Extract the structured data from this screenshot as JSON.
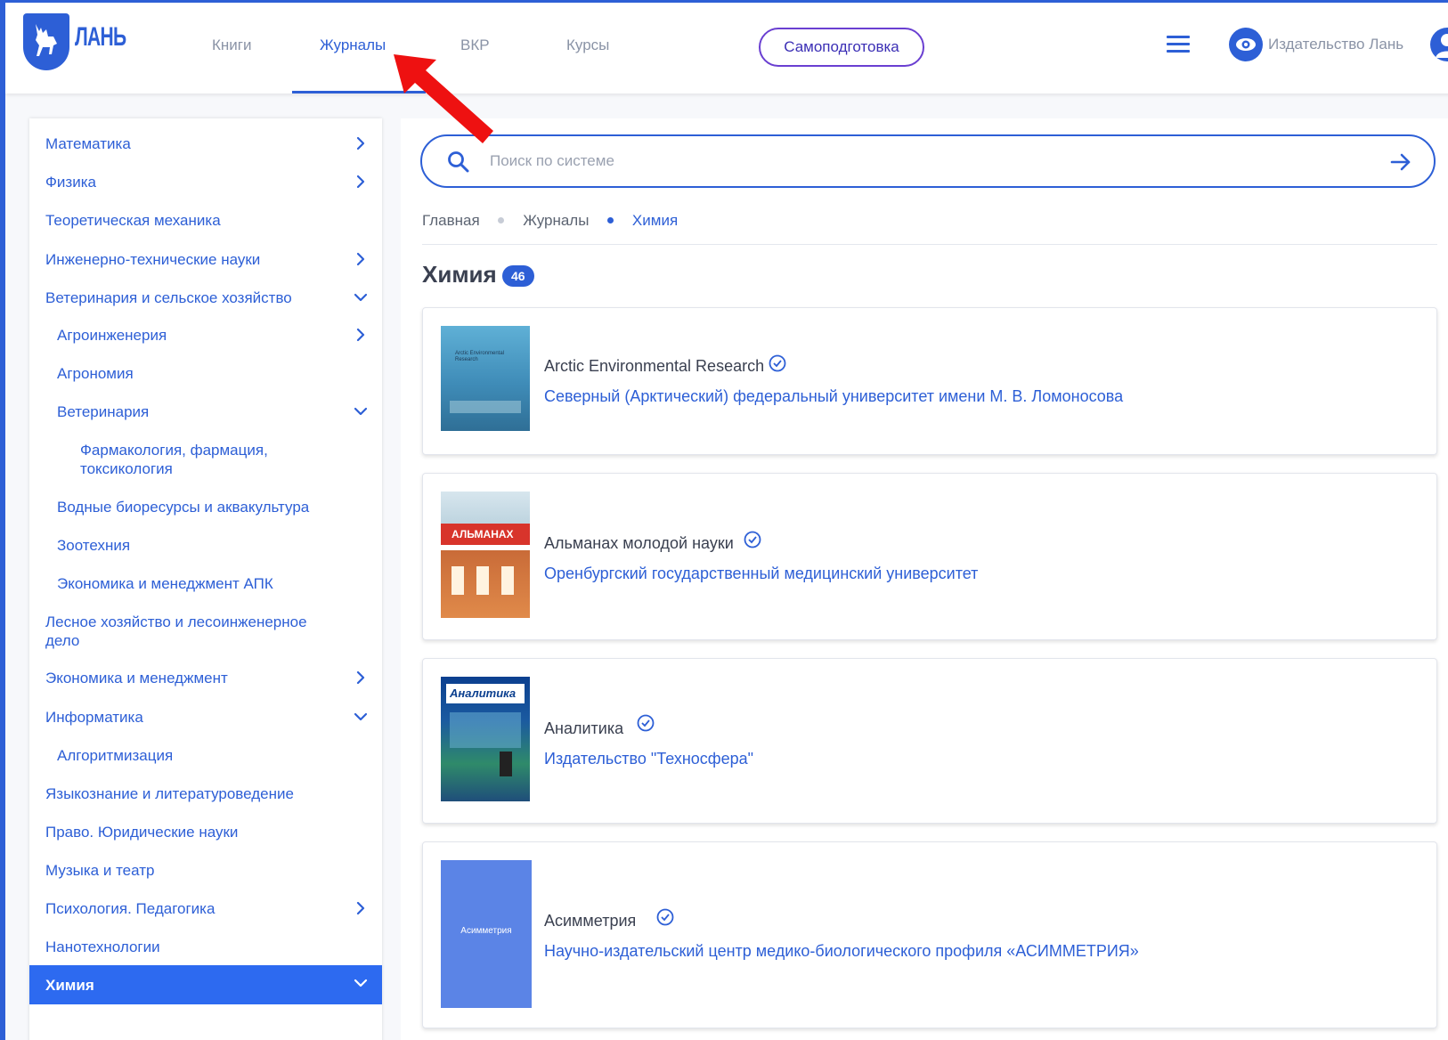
{
  "header": {
    "logo_text": "ЛАНЬ",
    "nav": [
      "Книги",
      "Журналы",
      "ВКР",
      "Курсы"
    ],
    "active_nav": "Журналы",
    "self_prep_label": "Самоподготовка",
    "publisher_label": "Издательство Лань"
  },
  "sidebar": {
    "items": [
      {
        "label": "Математика",
        "chevron": "right"
      },
      {
        "label": "Физика",
        "chevron": "right"
      },
      {
        "label": "Теоретическая механика",
        "chevron": ""
      },
      {
        "label": "Инженерно-технические науки",
        "chevron": "right"
      },
      {
        "label": "Ветеринария и сельское хозяйство",
        "chevron": "down"
      },
      {
        "label": "Агроинженерия",
        "chevron": "right"
      },
      {
        "label": "Агрономия",
        "chevron": ""
      },
      {
        "label": "Ветеринария",
        "chevron": "down"
      },
      {
        "label": "Фармакология, фармация, токсикология",
        "chevron": ""
      },
      {
        "label": "Водные биоресурсы и аквакультура",
        "chevron": ""
      },
      {
        "label": "Зоотехния",
        "chevron": ""
      },
      {
        "label": "Экономика и менеджмент АПК",
        "chevron": ""
      },
      {
        "label": "Лесное хозяйство и лесоинженерное дело",
        "chevron": ""
      },
      {
        "label": "Экономика и менеджмент",
        "chevron": "right"
      },
      {
        "label": "Информатика",
        "chevron": "down"
      },
      {
        "label": "Алгоритмизация",
        "chevron": ""
      },
      {
        "label": "Языкознание и литературоведение",
        "chevron": ""
      },
      {
        "label": "Право. Юридические науки",
        "chevron": ""
      },
      {
        "label": "Музыка и театр",
        "chevron": ""
      },
      {
        "label": "Психология. Педагогика",
        "chevron": "right"
      },
      {
        "label": "Нанотехнологии",
        "chevron": ""
      },
      {
        "label": "Химия",
        "chevron": "down",
        "active": true
      }
    ]
  },
  "search": {
    "placeholder": "Поиск по системе"
  },
  "breadcrumb": [
    "Главная",
    "Журналы",
    "Химия"
  ],
  "page": {
    "title": "Химия",
    "count": "46"
  },
  "journals": [
    {
      "title": "Arctic Environmental Research",
      "publisher": "Северный (Арктический) федеральный университет имени М. В. Ломоносова",
      "cover_text": "Arctic Environmental Research"
    },
    {
      "title": "Альманах молодой науки",
      "publisher": "Оренбургский государственный медицинский университет",
      "cover_text": "АЛЬМАНАХ"
    },
    {
      "title": "Аналитика",
      "publisher": "Издательство \"Техносфера\"",
      "cover_text": "Аналитика"
    },
    {
      "title": "Асимметрия",
      "publisher": "Научно-издательский центр медико-биологического профиля «АСИММЕТРИЯ»",
      "cover_text": "Асимметрия"
    }
  ],
  "colors": {
    "accent": "#2d5fd6",
    "active_sidebar": "#2d6af0",
    "annotation_arrow": "#ee1111"
  }
}
